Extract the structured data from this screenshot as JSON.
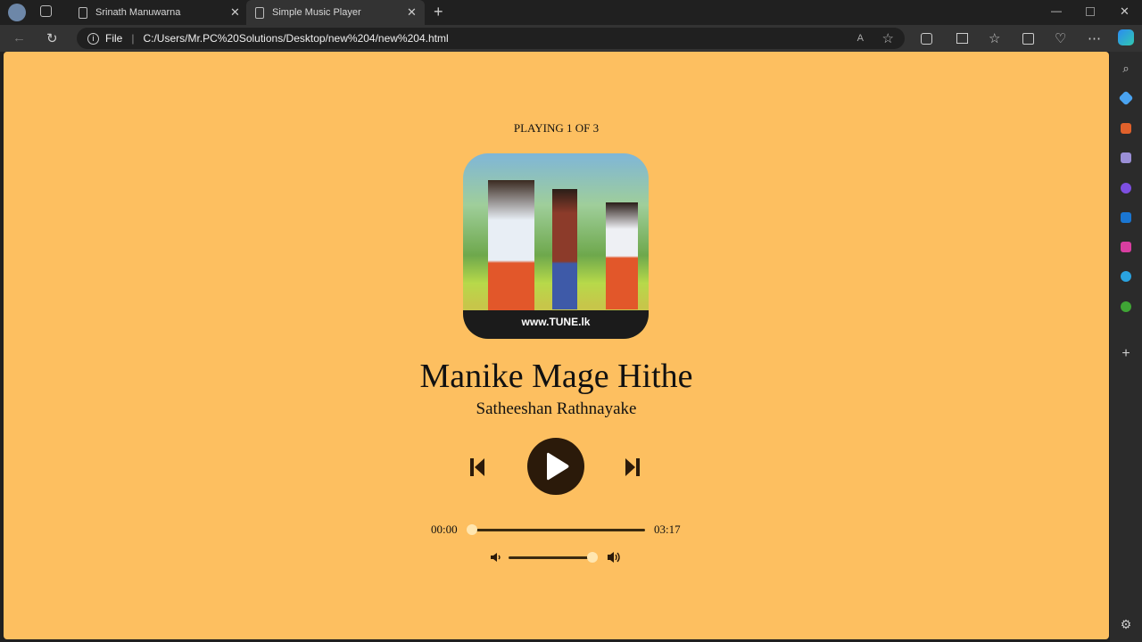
{
  "browser": {
    "tabs": [
      {
        "title": "Srinath Manuwarna"
      },
      {
        "title": "Simple Music Player"
      }
    ],
    "address": {
      "scheme_label": "File",
      "url": "C:/Users/Mr.PC%20Solutions/Desktop/new%204/new%204.html"
    }
  },
  "player": {
    "status": "PLAYING 1 OF 3",
    "track_title": "Manike Mage Hithe",
    "artist": "Satheeshan Rathnayake",
    "art_watermark": "www.TUNE.lk",
    "current_time": "00:00",
    "duration": "03:17",
    "progress": 0,
    "volume": 1.0
  },
  "colors": {
    "page_bg": "#fdbf60",
    "control_dark": "#2b1a0a",
    "browser_bg": "#202020"
  }
}
